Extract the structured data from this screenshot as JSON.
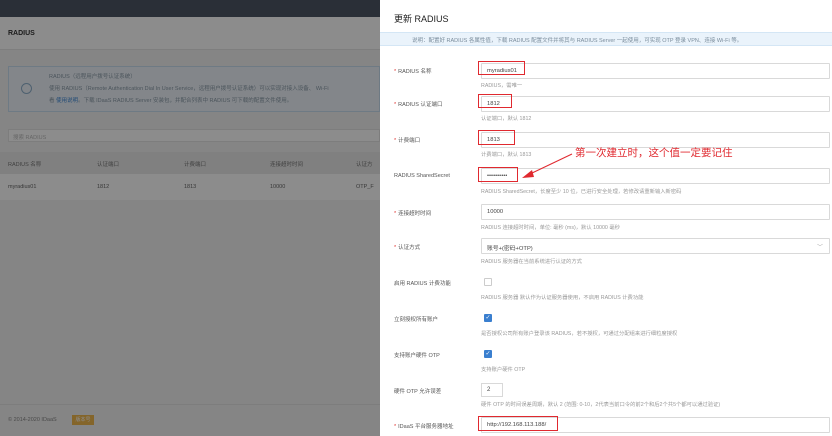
{
  "background": {
    "title": "RADIUS",
    "notice": {
      "heading": "RADIUS（远程用户拨号认证系统）",
      "line1": "使用 RADIUS（Remote Authentication Dial In User Service，远程用户拨号认证系统）可以实现对接入设备、",
      "line1_suffix": "Wi-Fi",
      "line2_prefix": "看",
      "link": "使用说明",
      "line2_suffix": "。下载 IDaaS RADIUS Server 安装包，并配合列表中 RADIUS 可下载的配置文件使用。"
    },
    "search_placeholder": "搜索 RADIUS",
    "columns": [
      "RADIUS 名称",
      "认证端口",
      "计费端口",
      "连接超时时间",
      "认证方"
    ],
    "rows": [
      {
        "name": "myradius01",
        "auth_port": "1812",
        "acct_port": "1813",
        "timeout": "10000",
        "method": "OTP_F"
      }
    ],
    "footer": {
      "copyright": "© 2014-2020 IDaaS",
      "badge": "版本号"
    }
  },
  "drawer": {
    "title": "更新 RADIUS",
    "description": "说明：配置好 RADIUS 各属性值，下载 RADIUS 配置文件并将其与 RADIUS Server 一起使用，可实现 OTP 登录 VPN、连接 Wi-Fi 等。",
    "fields": {
      "name": {
        "label": "RADIUS 名称",
        "value": "myradius01",
        "help": "RADIUS，需唯一"
      },
      "auth_port": {
        "label": "RADIUS 认证端口",
        "value": "1812",
        "help": "认证端口，默认 1812"
      },
      "acct_port": {
        "label": "计费端口",
        "value": "1813",
        "help": "计费端口，默认 1813"
      },
      "secret": {
        "label": "RADIUS SharedSecret",
        "value": "••••••••••",
        "help": "RADIUS SharedSecret，长度至少 10 位，已进行安全处理，若修改请重新输入新密码"
      },
      "timeout": {
        "label": "连接超时时间",
        "value": "10000",
        "help": "RADIUS 连接超时时间，单位: 毫秒 (ms)，默认 10000 毫秒"
      },
      "auth_method": {
        "label": "认证方式",
        "value": "账号+(密码+OTP)",
        "help": "RADIUS 服务器在当前系统进行认证的方式"
      },
      "accounting": {
        "label": "启用 RADIUS 计费功能",
        "checked": false,
        "help": "RADIUS 服务器 默认作为认证服务器使用，不启用 RADIUS 计费功能"
      },
      "authorize_all": {
        "label": "立刻授权所有账户",
        "checked": true,
        "help": "是否授权公司所有账户登录该 RADIUS，若不授权，可通过分配组来进行细粒度授权"
      },
      "hw_otp": {
        "label": "支持账户硬件 OTP",
        "checked": true,
        "help": "支持账户硬件 OTP"
      },
      "otp_window": {
        "label": "硬件 OTP 允许误差",
        "value": "2",
        "help": "硬件 OTP 的时间误差周期，默认 2 (范围: 0-10，2代表当前口令的前2个和后2个共5个都可以通过验证)"
      },
      "server_addr": {
        "label": "IDaaS 平台服务器地址",
        "value": "http://192.168.113.188/"
      }
    }
  },
  "annotation": {
    "text": "第一次建立时，这个值一定要记住"
  },
  "colors": {
    "highlight": "#e0292f",
    "required": "#e0322f",
    "checkbox": "#3a7fcf",
    "topbar": "#4d5665"
  }
}
